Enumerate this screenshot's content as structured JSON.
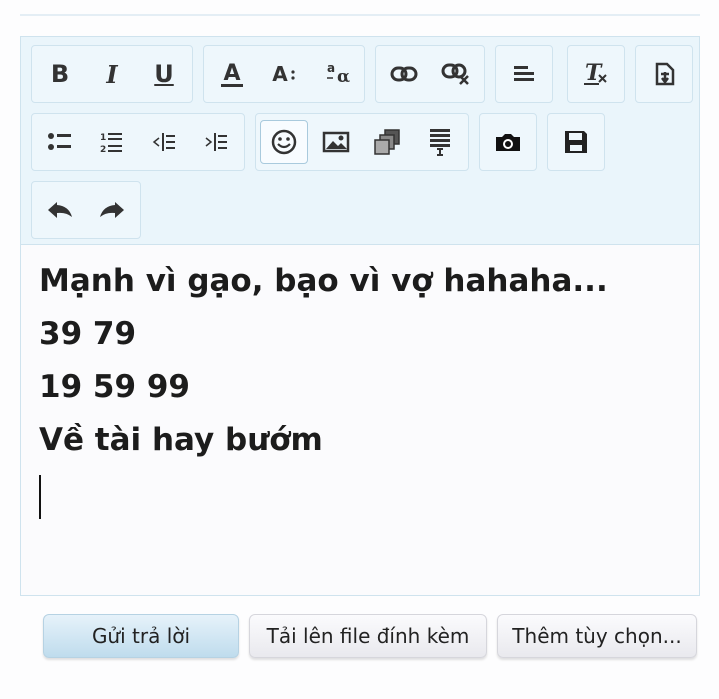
{
  "toolbar": {
    "row1": [
      {
        "name": "bold-button",
        "glyph": "B"
      },
      {
        "name": "italic-button",
        "glyph": "I"
      },
      {
        "name": "underline-button",
        "glyph": "U"
      },
      {
        "name": "font-color-button",
        "glyph": "A"
      },
      {
        "name": "font-size-button",
        "glyph": "A"
      },
      {
        "name": "font-family-button",
        "glyph": "a"
      }
    ],
    "active": "smilie-button"
  },
  "editor": {
    "lines": [
      "Mạnh vì gạo, bạo vì vợ hahaha...",
      "39 79",
      "19 59 99",
      "Về tài hay bướm"
    ]
  },
  "actions": {
    "reply_label": "Gửi trả lời",
    "upload_label": "Tải lên file đính kèm",
    "more_label": "Thêm tùy chọn..."
  },
  "colors": {
    "toolbar_bg": "#eaf5fb",
    "border": "#cfe3ee",
    "primary_button": "#bfdced"
  }
}
